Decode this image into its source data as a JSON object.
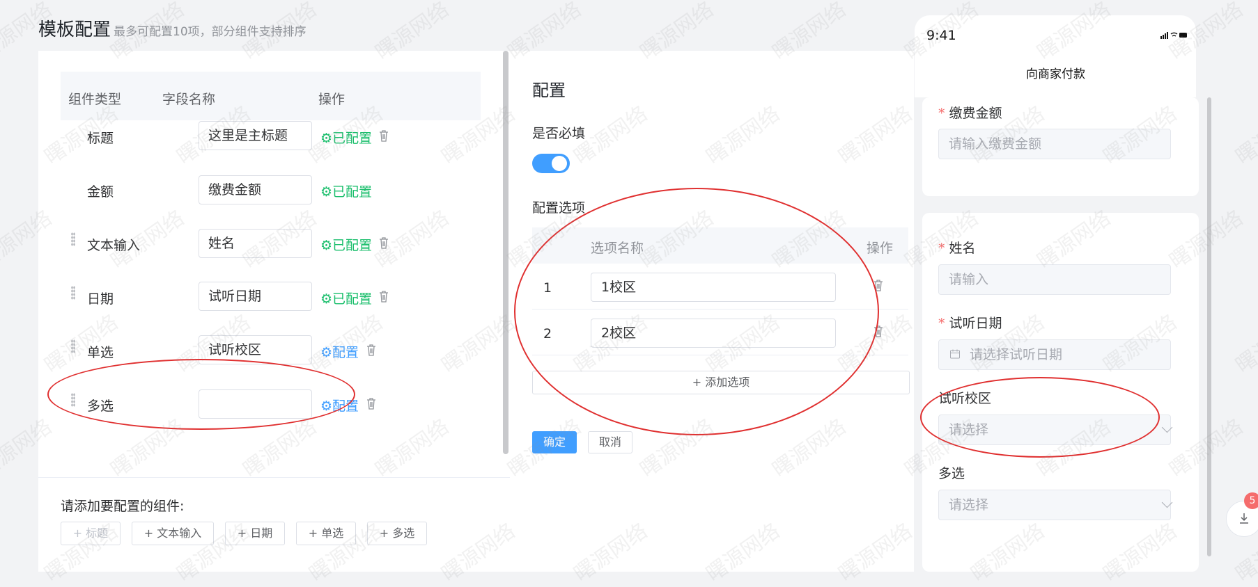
{
  "header": {
    "title": "模板配置",
    "subtitle": "最多可配置10项，部分组件支持排序"
  },
  "left_table": {
    "columns": [
      "组件类型",
      "字段名称",
      "操作"
    ],
    "rows": [
      {
        "type": "标题",
        "field": "这里是主标题",
        "status": "⚙已配置",
        "configured": true,
        "deletable": true,
        "draggable": false
      },
      {
        "type": "金额",
        "field": "缴费金额",
        "status": "⚙已配置",
        "configured": true,
        "deletable": false,
        "draggable": false
      },
      {
        "type": "文本输入",
        "field": "姓名",
        "status": "⚙已配置",
        "configured": true,
        "deletable": true,
        "draggable": true
      },
      {
        "type": "日期",
        "field": "试听日期",
        "status": "⚙已配置",
        "configured": true,
        "deletable": true,
        "draggable": true
      },
      {
        "type": "单选",
        "field": "试听校区",
        "status": "⚙配置",
        "configured": false,
        "deletable": true,
        "draggable": true
      },
      {
        "type": "多选",
        "field": "",
        "status": "⚙配置",
        "configured": false,
        "deletable": true,
        "draggable": true
      }
    ],
    "add_label": "请添加要配置的组件:",
    "add_buttons": [
      "+ 标题",
      "+ 文本输入",
      "+ 日期",
      "+ 单选",
      "+ 多选"
    ]
  },
  "config": {
    "title": "配置",
    "required_label": "是否必填",
    "required_on": true,
    "options_label": "配置选项",
    "option_columns": [
      "选项名称",
      "操作"
    ],
    "options": [
      {
        "index": "1",
        "name": "1校区"
      },
      {
        "index": "2",
        "name": "2校区"
      }
    ],
    "add_option": "+ 添加选项",
    "confirm": "确定",
    "cancel": "取消"
  },
  "phone": {
    "time": "9:41",
    "nav_title": "向商家付款",
    "fields": [
      {
        "label": "缴费金额",
        "required": "*",
        "placeholder": "请输入缴费金额"
      },
      {
        "label": "姓名",
        "required": "*",
        "placeholder": "请输入"
      },
      {
        "label": "试听日期",
        "required": "*",
        "placeholder": "请选择试听日期"
      },
      {
        "label": "试听校区",
        "required": "",
        "placeholder": "请选择"
      },
      {
        "label": "多选",
        "required": "",
        "placeholder": "请选择"
      }
    ]
  },
  "download_badge": "5",
  "watermark": "曙源网络",
  "colors": {
    "primary": "#409eff",
    "success": "#19be6b",
    "danger": "#f56c6c",
    "annotation": "#e03030"
  }
}
